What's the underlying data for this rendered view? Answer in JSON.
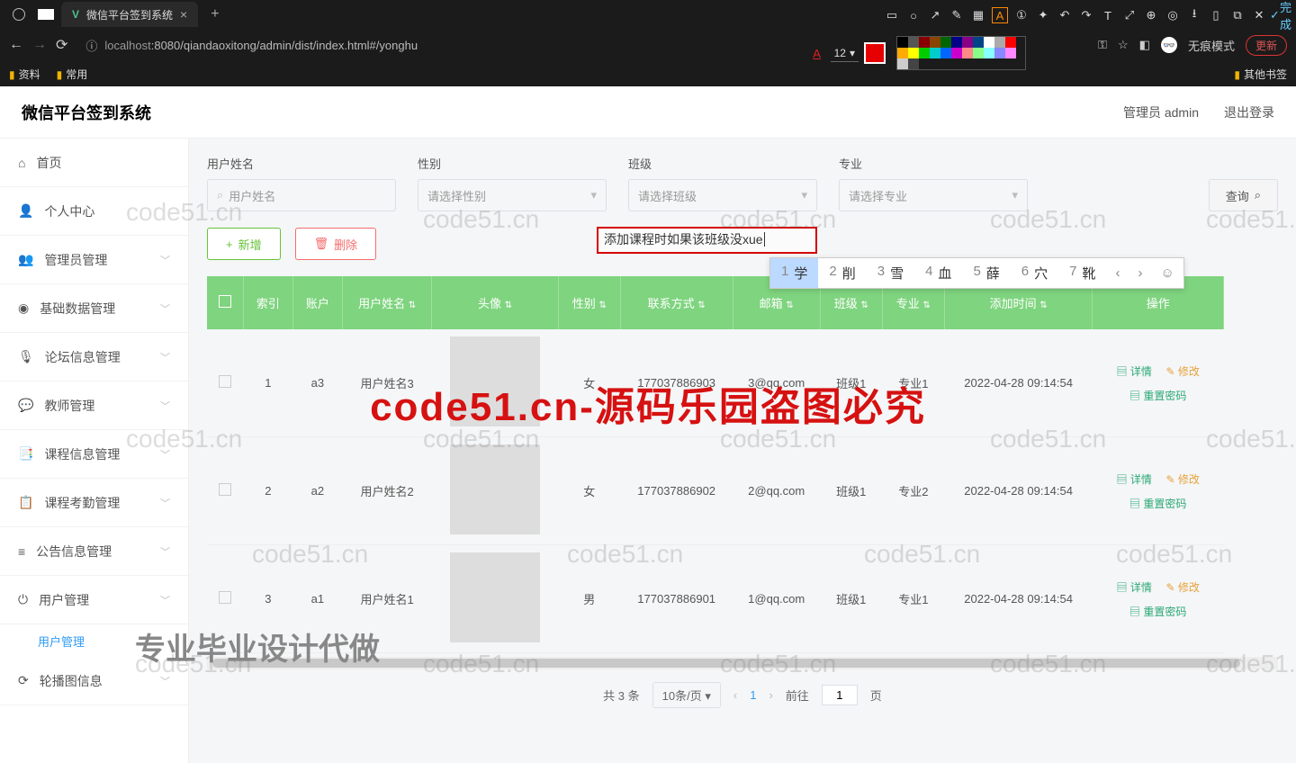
{
  "browser": {
    "tab_title": "微信平台签到系统",
    "url_host": "localhost",
    "url_path": ":8080/qiandaoxitong/admin/dist/index.html#/yonghu",
    "update_label": "更新",
    "incognito_label": "无痕模式",
    "done_label": "完成",
    "font_size": "12",
    "bookmarks": {
      "a": "资料",
      "b": "常用",
      "other": "其他书签"
    }
  },
  "header": {
    "title": "微信平台签到系统",
    "admin_label": "管理员 admin",
    "logout_label": "退出登录"
  },
  "sidebar": {
    "items": [
      {
        "icon": "⌂",
        "label": "首页",
        "exp": false
      },
      {
        "icon": "👤",
        "label": "个人中心",
        "exp": false
      },
      {
        "icon": "👥",
        "label": "管理员管理",
        "exp": true
      },
      {
        "icon": "◉",
        "label": "基础数据管理",
        "exp": true
      },
      {
        "icon": "🎙",
        "label": "论坛信息管理",
        "exp": true
      },
      {
        "icon": "💬",
        "label": "教师管理",
        "exp": true
      },
      {
        "icon": "📑",
        "label": "课程信息管理",
        "exp": true
      },
      {
        "icon": "📋",
        "label": "课程考勤管理",
        "exp": true
      },
      {
        "icon": "≡",
        "label": "公告信息管理",
        "exp": true
      },
      {
        "icon": "⏻",
        "label": "用户管理",
        "exp": true,
        "open": true
      },
      {
        "icon": "⟳",
        "label": "轮播图信息",
        "exp": true
      }
    ],
    "sub_label": "用户管理"
  },
  "filters": {
    "f1": {
      "label": "用户姓名",
      "ph": "用户姓名"
    },
    "f2": {
      "label": "性别",
      "ph": "请选择性别"
    },
    "f3": {
      "label": "班级",
      "ph": "请选择班级"
    },
    "f4": {
      "label": "专业",
      "ph": "请选择专业"
    },
    "query": "查询"
  },
  "ops": {
    "add": "新增",
    "del": "删除"
  },
  "annotation": "添加课程时如果该班级没xue",
  "ime": {
    "opts": [
      [
        "1",
        "学"
      ],
      [
        "2",
        "削"
      ],
      [
        "3",
        "雪"
      ],
      [
        "4",
        "血"
      ],
      [
        "5",
        "薛"
      ],
      [
        "6",
        "穴"
      ],
      [
        "7",
        "靴"
      ]
    ]
  },
  "table": {
    "headers": [
      "",
      "索引",
      "账户",
      "用户姓名",
      "头像",
      "性别",
      "联系方式",
      "邮箱",
      "班级",
      "专业",
      "添加时间",
      "操作"
    ],
    "rows": [
      {
        "idx": "1",
        "acc": "a3",
        "name": "用户姓名3",
        "sex": "女",
        "phone": "177037886903",
        "email": "3@qq.com",
        "cls": "班级1",
        "major": "专业1",
        "time": "2022-04-28 09:14:54"
      },
      {
        "idx": "2",
        "acc": "a2",
        "name": "用户姓名2",
        "sex": "女",
        "phone": "177037886902",
        "email": "2@qq.com",
        "cls": "班级1",
        "major": "专业2",
        "time": "2022-04-28 09:14:54"
      },
      {
        "idx": "3",
        "acc": "a1",
        "name": "用户姓名1",
        "sex": "男",
        "phone": "177037886901",
        "email": "1@qq.com",
        "cls": "班级1",
        "major": "专业1",
        "time": "2022-04-28 09:14:54"
      }
    ],
    "actions": {
      "detail": "详情",
      "edit": "修改",
      "reset": "重置密码"
    }
  },
  "pager": {
    "total": "共 3 条",
    "per": "10条/页",
    "current": "1",
    "goto": "前往",
    "goto_val": "1",
    "unit": "页"
  },
  "watermarks": {
    "main": "code51.cn-源码乐园盗图必究",
    "code": "code51.cn",
    "prof": "专业毕业设计代做"
  }
}
